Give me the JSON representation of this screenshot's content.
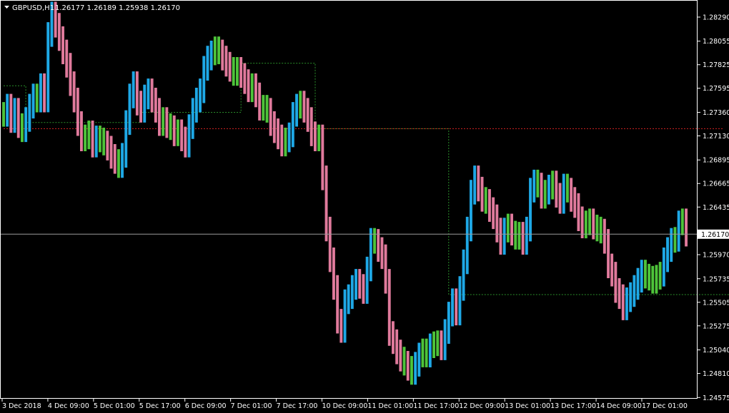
{
  "header": {
    "symbol": "GBPUSD,H1",
    "ohlc": "1.26177 1.26189 1.25938 1.26170"
  },
  "current_price_label": "1.26170",
  "colors": {
    "background": "#000000",
    "frame": "#ffffff",
    "bull_bar": "#1ea8e6",
    "bear_bar": "#e07a9c",
    "neutral_bar": "#4ec43a",
    "upper_channel": "#2a8f2a",
    "lower_channel": "#d22222",
    "bid_line": "#9a9a9a"
  },
  "chart_data": {
    "type": "bar",
    "symbol": "GBPUSD",
    "timeframe": "H1",
    "ylim": [
      1.2457,
      1.2845
    ],
    "current_price": 1.2617,
    "y_ticks": [
      "1.28290",
      "1.28055",
      "1.27825",
      "1.27595",
      "1.27360",
      "1.27130",
      "1.26895",
      "1.26665",
      "1.26435",
      "1.26170",
      "1.25970",
      "1.25735",
      "1.25505",
      "1.25275",
      "1.25040",
      "1.24810",
      "1.24575"
    ],
    "x_ticks": [
      "3 Dec 2018",
      "4 Dec 09:00",
      "5 Dec 01:00",
      "5 Dec 17:00",
      "6 Dec 09:00",
      "7 Dec 01:00",
      "7 Dec 17:00",
      "10 Dec 09:00",
      "11 Dec 01:00",
      "11 Dec 17:00",
      "12 Dec 09:00",
      "13 Dec 01:00",
      "13 Dec 17:00",
      "14 Dec 09:00",
      "17 Dec 01:00"
    ],
    "series": [
      {
        "name": "",
        "kind": "price_bars",
        "values": [
          1.2734,
          1.2742,
          1.2728,
          1.2738,
          1.2723,
          1.2719,
          1.2729,
          1.2742,
          1.2752,
          1.2748,
          1.2762,
          1.2748,
          1.2812,
          1.2832,
          1.2821,
          1.2808,
          1.2795,
          1.2782,
          1.2764,
          1.2748,
          1.2725,
          1.271,
          1.2712,
          1.2716,
          1.2704,
          1.2711,
          1.2709,
          1.2706,
          1.2701,
          1.2693,
          1.2688,
          1.2684,
          1.2694,
          1.2726,
          1.2752,
          1.2764,
          1.2745,
          1.2738,
          1.2751,
          1.2757,
          1.2748,
          1.2738,
          1.2725,
          1.2729,
          1.2723,
          1.2721,
          1.2715,
          1.2717,
          1.271,
          1.2704,
          1.2722,
          1.2738,
          1.2748,
          1.2757,
          1.2779,
          1.2789,
          1.2794,
          1.2798,
          1.2795,
          1.2789,
          1.2783,
          1.2778,
          1.2774,
          1.2778,
          1.2772,
          1.2766,
          1.2758,
          1.2762,
          1.2753,
          1.274,
          1.2741,
          1.2738,
          1.2725,
          1.2718,
          1.2712,
          1.2705,
          1.2709,
          1.2714,
          1.2734,
          1.2742,
          1.2745,
          1.2738,
          1.2729,
          1.2715,
          1.271,
          1.2712,
          1.2672,
          1.2622,
          1.2592,
          1.2565,
          1.2532,
          1.2523,
          1.2551,
          1.2556,
          1.2565,
          1.2571,
          1.2566,
          1.2561,
          1.2583,
          1.2611,
          1.261,
          1.2602,
          1.2595,
          1.2571,
          1.252,
          1.2512,
          1.2502,
          1.2495,
          1.2491,
          1.2486,
          1.2482,
          1.249,
          1.2499,
          1.2503,
          1.2499,
          1.2508,
          1.251,
          1.2511,
          1.2506,
          1.2522,
          1.2539,
          1.2552,
          1.254,
          1.2564,
          1.259,
          1.2622,
          1.2658,
          1.2672,
          1.2661,
          1.2651,
          1.2649,
          1.2641,
          1.2634,
          1.2621,
          1.2609,
          1.2621,
          1.2625,
          1.2618,
          1.2614,
          1.2617,
          1.2609,
          1.2622,
          1.266,
          1.2668,
          1.2665,
          1.2654,
          1.2658,
          1.2663,
          1.2667,
          1.2655,
          1.2649,
          1.2664,
          1.266,
          1.2651,
          1.2645,
          1.2632,
          1.2625,
          1.2628,
          1.263,
          1.2624,
          1.2622,
          1.262,
          1.261,
          1.2586,
          1.2578,
          1.2562,
          1.2556,
          1.2545,
          1.2553,
          1.2558,
          1.2565,
          1.2572,
          1.258,
          1.2576,
          1.2574,
          1.2571,
          1.2575,
          1.2578,
          1.2592,
          1.2602,
          1.2611,
          1.2612,
          1.2628,
          1.263,
          1.2617
        ]
      },
      {
        "name": "",
        "kind": "upper_channel_line",
        "values": [
          1.2762,
          1.2762,
          1.2762,
          1.2762,
          1.2762,
          1.2762,
          1.2726,
          1.2726,
          1.2726,
          1.2726,
          1.2726,
          1.2726,
          1.2726,
          1.2726,
          1.2726,
          1.2726,
          1.2726,
          1.2726,
          1.2726,
          1.2726,
          1.2726,
          1.2726,
          1.2726,
          1.2726,
          1.2726,
          1.2726,
          1.2726,
          1.2726,
          1.2726,
          1.2726,
          1.2726,
          1.2726,
          1.2726,
          1.2726,
          1.2726,
          1.2726,
          1.2726,
          1.2736,
          1.2736,
          1.2736,
          1.2736,
          1.2736,
          1.2736,
          1.2736,
          1.2736,
          1.2736,
          1.2736,
          1.2736,
          1.2736,
          1.2736,
          1.2736,
          1.2736,
          1.2736,
          1.2736,
          1.2736,
          1.2736,
          1.2736,
          1.2736,
          1.2736,
          1.2736,
          1.2736,
          1.2736,
          1.2736,
          1.2736,
          1.2784,
          1.2784,
          1.2784,
          1.2784,
          1.2784,
          1.2784,
          1.2784,
          1.2784,
          1.2784,
          1.2784,
          1.2784,
          1.2784,
          1.2784,
          1.2784,
          1.2784,
          1.2784,
          1.2784,
          1.2784,
          1.2784,
          1.2784,
          1.272,
          1.272,
          1.272,
          1.272,
          1.272,
          1.272,
          1.272,
          1.272,
          1.272,
          1.272,
          1.272,
          1.272,
          1.272,
          1.272,
          1.272,
          1.272,
          1.272,
          1.272,
          1.272,
          1.272,
          1.272,
          1.272,
          1.272,
          1.272,
          1.272,
          1.272,
          1.272,
          1.272,
          1.272,
          1.272,
          1.272,
          1.272,
          1.272,
          1.272,
          1.272,
          1.272,
          1.2558,
          1.2558,
          1.2558,
          1.2558,
          1.2558,
          1.2558,
          1.2558,
          1.2558,
          1.2558,
          1.2558,
          1.2558,
          1.2558,
          1.2558,
          1.2558,
          1.2558,
          1.2558,
          1.2558,
          1.2558,
          1.2558,
          1.2558,
          1.2558,
          1.2558,
          1.2558,
          1.2558,
          1.2558,
          1.2558,
          1.2558,
          1.2558,
          1.2558,
          1.2558,
          1.2558,
          1.2558,
          1.2558,
          1.2558,
          1.2558,
          1.2558,
          1.2558,
          1.2558,
          1.2558,
          1.2558,
          1.2558,
          1.2558,
          1.2558,
          1.2558,
          1.2558,
          1.2558,
          1.2558,
          1.2558,
          1.2558,
          1.2558,
          1.2558,
          1.2558,
          1.2558,
          1.2558,
          1.2558,
          1.2558,
          1.2558,
          1.2558,
          1.2558,
          1.2558,
          1.2558,
          1.2558,
          1.2558,
          1.2558,
          1.2558,
          1.2558,
          1.2558,
          1.2558,
          1.2558,
          1.2558,
          1.2558,
          1.2558,
          1.2558,
          1.2558,
          1.2558,
          1.2558,
          1.2558,
          1.2558,
          1.2558,
          1.2558,
          1.2558,
          1.2558
        ]
      },
      {
        "name": "",
        "kind": "lower_channel_line",
        "values": [
          1.272,
          1.272,
          1.272,
          1.272,
          1.272,
          1.272,
          1.272,
          1.272,
          1.272,
          1.272,
          1.272,
          1.272,
          1.272,
          1.272,
          1.272,
          1.272,
          1.272,
          1.272,
          1.272,
          1.272,
          1.272,
          1.272,
          1.272,
          1.272,
          1.272,
          1.272,
          1.272,
          1.272,
          1.272,
          1.272,
          1.272,
          1.272,
          1.272,
          1.272,
          1.272,
          1.272,
          1.272,
          1.272,
          1.272,
          1.272,
          1.272,
          1.272,
          1.272,
          1.272,
          1.272,
          1.272,
          1.272,
          1.272,
          1.272,
          1.272,
          1.272,
          1.272,
          1.272,
          1.272,
          1.272,
          1.272,
          1.272,
          1.272,
          1.272,
          1.272,
          1.272,
          1.272,
          1.272,
          1.272,
          1.272,
          1.272,
          1.272,
          1.272,
          1.272,
          1.272,
          1.272,
          1.272,
          1.272,
          1.272,
          1.272,
          1.272,
          1.272,
          1.272,
          1.272,
          1.272,
          1.272,
          1.272,
          1.272,
          1.272,
          1.272,
          1.272,
          1.272,
          1.272,
          1.272,
          1.272,
          1.272,
          1.272,
          1.272,
          1.272,
          1.272,
          1.272,
          1.272,
          1.272,
          1.272,
          1.272,
          1.272,
          1.272,
          1.272,
          1.272,
          1.272,
          1.272,
          1.272,
          1.272,
          1.272,
          1.272,
          1.272,
          1.272,
          1.272,
          1.272,
          1.272,
          1.272,
          1.272,
          1.272,
          1.272,
          1.272,
          1.272,
          1.272,
          1.272,
          1.272,
          1.272,
          1.272,
          1.272,
          1.272,
          1.272,
          1.272,
          1.272,
          1.272,
          1.272,
          1.272,
          1.272,
          1.272,
          1.272,
          1.272,
          1.272,
          1.272,
          1.272,
          1.272,
          1.272,
          1.272,
          1.272,
          1.272,
          1.272,
          1.272,
          1.272,
          1.272,
          1.272,
          1.272,
          1.272,
          1.272,
          1.272,
          1.272,
          1.272,
          1.272,
          1.272,
          1.272,
          1.272,
          1.272,
          1.272,
          1.272,
          1.272,
          1.272,
          1.272,
          1.272,
          1.272,
          1.272,
          1.272,
          1.272,
          1.272,
          1.272,
          1.272,
          1.272,
          1.272,
          1.272,
          1.272,
          1.272,
          1.272,
          1.272,
          1.272,
          1.272,
          1.272,
          1.272,
          1.272,
          1.272,
          1.272,
          1.272,
          1.272,
          1.272,
          1.272,
          1.272,
          1.272
        ]
      }
    ]
  }
}
